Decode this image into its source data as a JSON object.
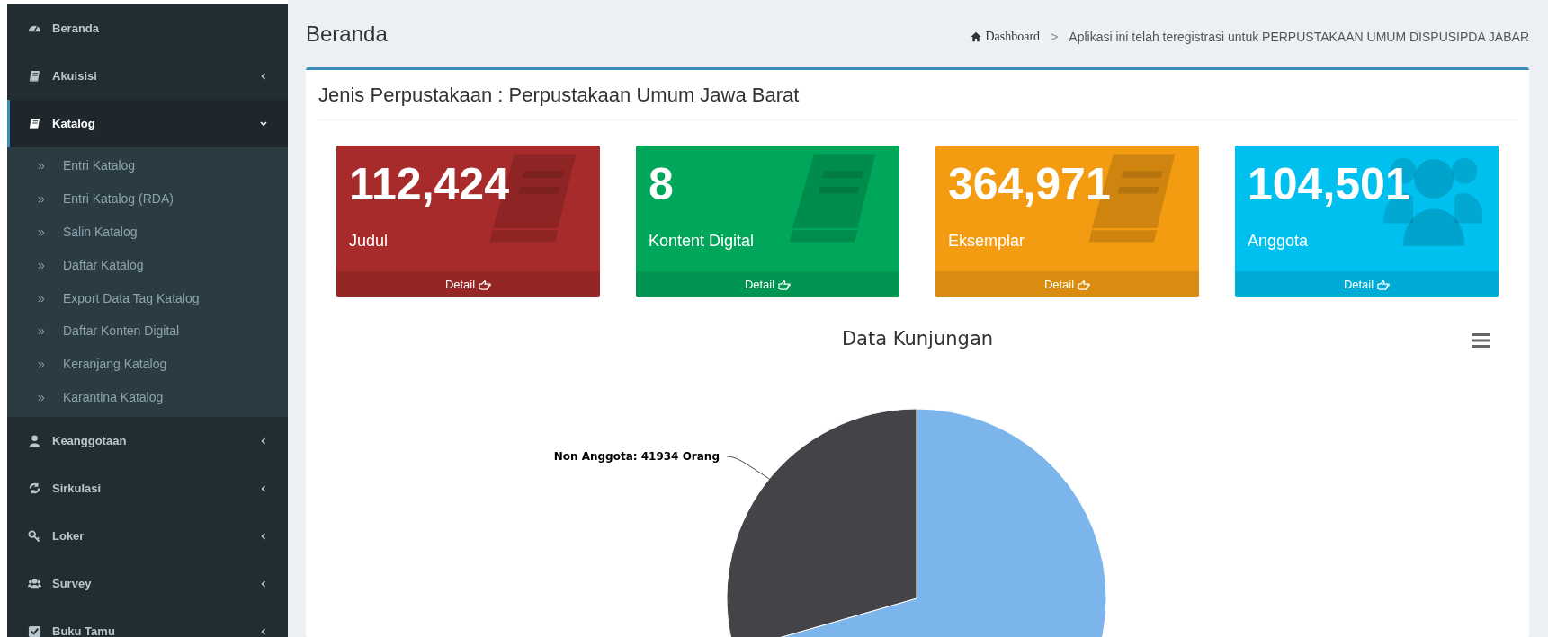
{
  "sidebar": {
    "items": [
      {
        "label": "Beranda",
        "selected": false
      },
      {
        "label": "Akuisisi",
        "selected": false,
        "expanded": false
      },
      {
        "label": "Katalog",
        "selected": true,
        "expanded": true,
        "children": [
          {
            "label": "Entri Katalog",
            "icon": "»"
          },
          {
            "label": "Entri Katalog (RDA)",
            "icon": "»"
          },
          {
            "label": "Salin Katalog",
            "icon": "»"
          },
          {
            "label": "Daftar Katalog",
            "icon": "»"
          },
          {
            "label": "Export Data Tag Katalog",
            "icon": "»"
          },
          {
            "label": "Daftar Konten Digital",
            "icon": "»"
          },
          {
            "label": "Keranjang Katalog",
            "icon": "»"
          },
          {
            "label": "Karantina Katalog",
            "icon": "»"
          }
        ]
      },
      {
        "label": "Keanggotaan",
        "selected": false,
        "expanded": false
      },
      {
        "label": "Sirkulasi",
        "selected": false,
        "expanded": false
      },
      {
        "label": "Loker",
        "selected": false,
        "expanded": false
      },
      {
        "label": "Survey",
        "selected": false,
        "expanded": false
      },
      {
        "label": "Buku Tamu",
        "selected": false,
        "expanded": false
      }
    ]
  },
  "page_title": "Beranda",
  "breadcrumb": {
    "home": "Dashboard",
    "separator": ">",
    "current": "Aplikasi ini telah teregistrasi untuk PERPUSTAKAAN UMUM DISPUSIPDA JABAR"
  },
  "box": {
    "title": "Jenis Perpustakaan : Perpustakaan Umum Jawa Barat",
    "cards": [
      {
        "value": "112,424",
        "label": "Judul",
        "footer": "Detail",
        "color": "#a72b2b",
        "kind": "book"
      },
      {
        "value": "8",
        "label": "Kontent Digital",
        "footer": "Detail",
        "color": "#00a65a",
        "kind": "book"
      },
      {
        "value": "364,971",
        "label": "Eksemplar",
        "footer": "Detail",
        "color": "#f39c12",
        "kind": "book"
      },
      {
        "value": "104,501",
        "label": "Anggota",
        "footer": "Detail",
        "color": "#00c0ef",
        "kind": "users"
      }
    ],
    "chart": {
      "title": "Data Kunjungan",
      "slice_label": "Non Anggota: 41934 Orang"
    }
  }
}
